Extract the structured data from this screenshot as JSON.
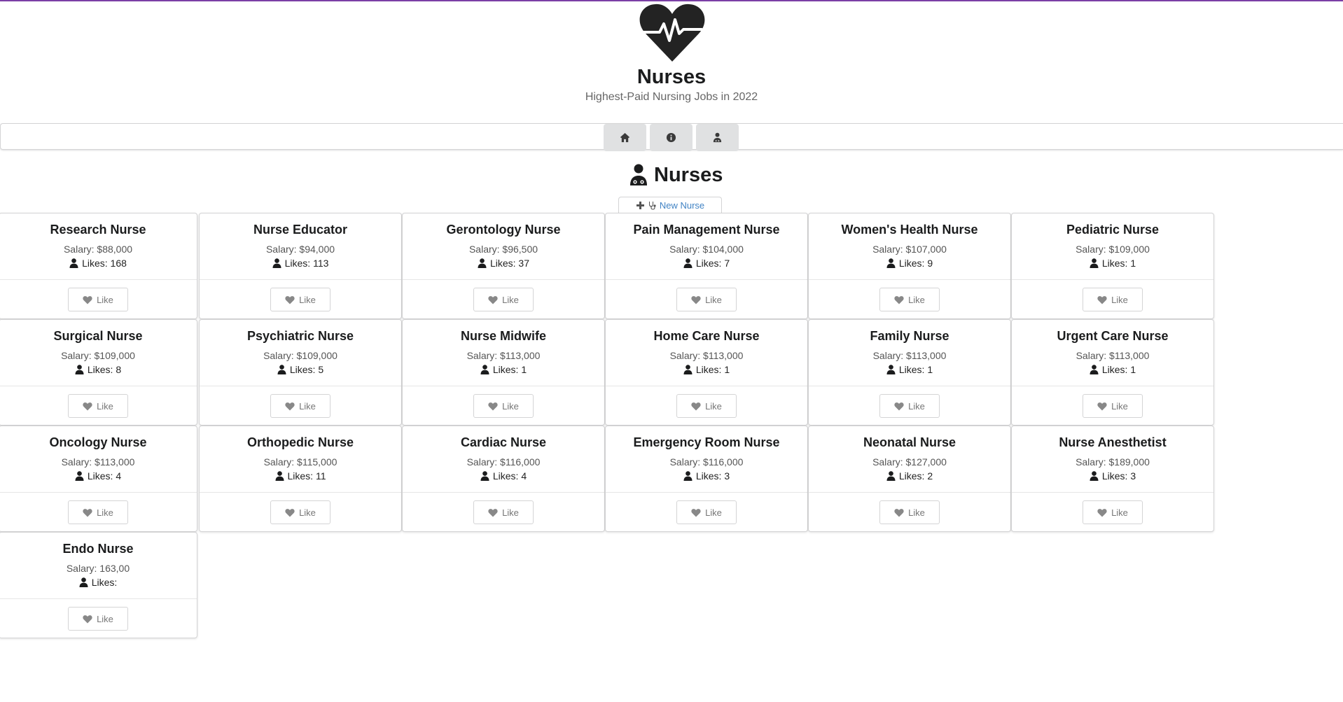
{
  "site": {
    "title": "Nurses",
    "subtitle": "Highest-Paid Nursing Jobs in 2022"
  },
  "nav": {
    "items": [
      {
        "id": "home",
        "icon": "home-icon"
      },
      {
        "id": "info",
        "icon": "info-circle-icon"
      },
      {
        "id": "nurses",
        "icon": "user-nurse-icon"
      }
    ]
  },
  "page": {
    "heading": "Nurses",
    "heading_icon": "user-nurse-icon",
    "new_button_label": "New Nurse"
  },
  "card_labels": {
    "like": "Like"
  },
  "nurses": [
    {
      "name": "Research Nurse",
      "salary": "Salary: $88,000",
      "likes": "Likes: 168"
    },
    {
      "name": "Nurse Educator",
      "salary": "Salary: $94,000",
      "likes": "Likes: 113"
    },
    {
      "name": "Gerontology Nurse",
      "salary": "Salary: $96,500",
      "likes": "Likes: 37"
    },
    {
      "name": "Pain Management Nurse",
      "salary": "Salary: $104,000",
      "likes": "Likes: 7"
    },
    {
      "name": "Women's Health Nurse",
      "salary": "Salary: $107,000",
      "likes": "Likes: 9"
    },
    {
      "name": "Pediatric Nurse",
      "salary": "Salary: $109,000",
      "likes": "Likes: 1"
    },
    {
      "name": "Surgical Nurse",
      "salary": "Salary: $109,000",
      "likes": "Likes: 8"
    },
    {
      "name": "Psychiatric Nurse",
      "salary": "Salary: $109,000",
      "likes": "Likes: 5"
    },
    {
      "name": "Nurse Midwife",
      "salary": "Salary: $113,000",
      "likes": "Likes: 1"
    },
    {
      "name": "Home Care Nurse",
      "salary": "Salary: $113,000",
      "likes": "Likes: 1"
    },
    {
      "name": "Family Nurse",
      "salary": "Salary: $113,000",
      "likes": "Likes: 1"
    },
    {
      "name": "Urgent Care Nurse",
      "salary": "Salary: $113,000",
      "likes": "Likes: 1"
    },
    {
      "name": "Oncology Nurse",
      "salary": "Salary: $113,000",
      "likes": "Likes: 4"
    },
    {
      "name": "Orthopedic Nurse",
      "salary": "Salary: $115,000",
      "likes": "Likes: 11"
    },
    {
      "name": "Cardiac Nurse",
      "salary": "Salary: $116,000",
      "likes": "Likes: 4"
    },
    {
      "name": "Emergency Room Nurse",
      "salary": "Salary: $116,000",
      "likes": "Likes: 3"
    },
    {
      "name": "Neonatal Nurse",
      "salary": "Salary: $127,000",
      "likes": "Likes: 2"
    },
    {
      "name": "Nurse Anesthetist",
      "salary": "Salary: $189,000",
      "likes": "Likes: 3"
    },
    {
      "name": "Endo Nurse",
      "salary": "Salary: 163,00",
      "likes": "Likes:"
    }
  ],
  "colors": {
    "top_border": "#7b3fa6",
    "link": "#4183c4",
    "menu_button": "#e0e1e2"
  }
}
